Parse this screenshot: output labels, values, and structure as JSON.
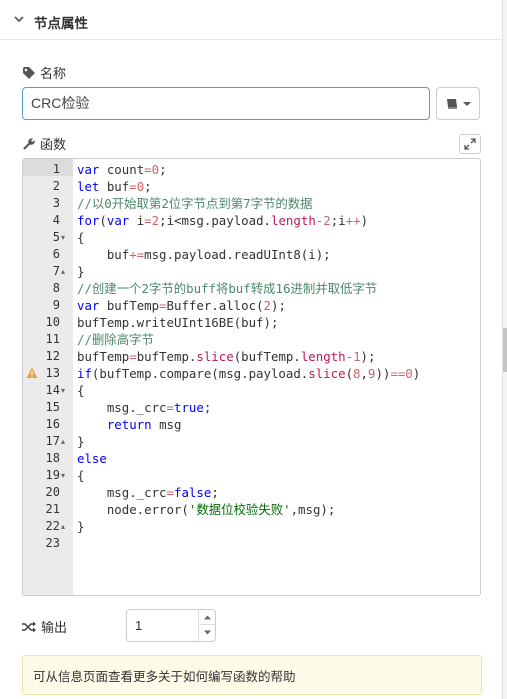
{
  "header": {
    "title": "节点属性"
  },
  "name_field": {
    "label": "名称",
    "value": "CRC检验"
  },
  "function_field": {
    "label": "函数"
  },
  "code": {
    "lines": [
      {
        "num": "1"
      },
      {
        "num": "2"
      },
      {
        "num": "3"
      },
      {
        "num": "4"
      },
      {
        "num": "5"
      },
      {
        "num": "6"
      },
      {
        "num": "7"
      },
      {
        "num": "8"
      },
      {
        "num": "9"
      },
      {
        "num": "10"
      },
      {
        "num": "11"
      },
      {
        "num": "12"
      },
      {
        "num": "13"
      },
      {
        "num": "14"
      },
      {
        "num": "15"
      },
      {
        "num": "16"
      },
      {
        "num": "17"
      },
      {
        "num": "18"
      },
      {
        "num": "19"
      },
      {
        "num": "20"
      },
      {
        "num": "21"
      },
      {
        "num": "22"
      },
      {
        "num": "23"
      }
    ],
    "text": [
      "var count=0;",
      "let buf=0;",
      "//以0开始取第2位字节点到第7字节的数据",
      "for(var i=2;i<msg.payload.length-2;i++)",
      "{",
      "    buf+=msg.payload.readUInt8(i);",
      "}",
      "//创建一个2字节的buff将buf转成16进制并取低字节",
      "var bufTemp=Buffer.alloc(2);",
      "bufTemp.writeUInt16BE(buf);",
      "//删除高字节",
      "bufTemp=bufTemp.slice(bufTemp.length-1);",
      "if(bufTemp.compare(msg.payload.slice(8,9))==0)",
      "{",
      "    msg._crc=true;",
      "    return msg",
      "}",
      "else",
      "{",
      "    msg._crc=false;",
      "    node.error('数据位校验失败',msg);",
      "}",
      ""
    ]
  },
  "outputs": {
    "label": "输出",
    "value": "1"
  },
  "help": {
    "text": "可从信息页面查看更多关于如何编写函数的帮助"
  },
  "colors": {
    "accent": "#4d9fd6",
    "keyword": "#0000ff",
    "string": "#036a07",
    "comment": "#4c886b",
    "warning": "#e8a33a"
  }
}
